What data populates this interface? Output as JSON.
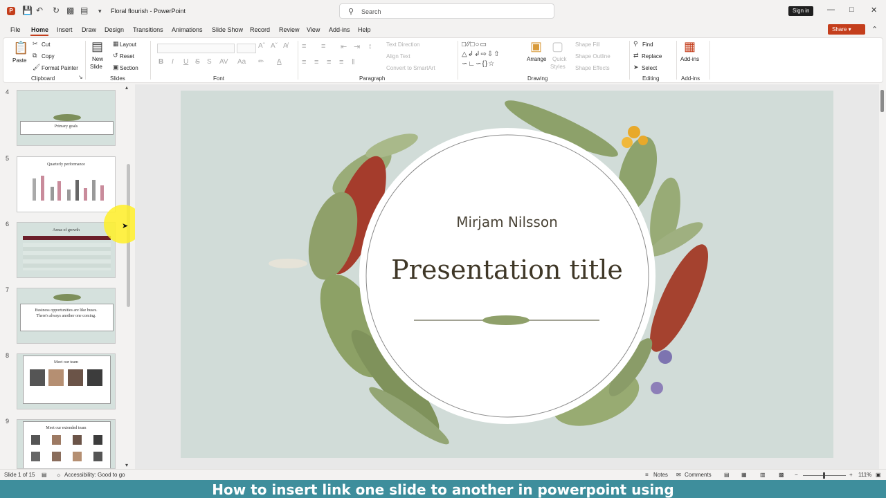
{
  "window": {
    "title": "Floral flourish  -  PowerPoint",
    "app_icon_letter": "P",
    "search_placeholder": "Search",
    "signin_label": "Sign in"
  },
  "menu": {
    "tabs": [
      "File",
      "Home",
      "Insert",
      "Draw",
      "Design",
      "Transitions",
      "Animations",
      "Slide Show",
      "Record",
      "Review",
      "View",
      "Add-ins",
      "Help"
    ],
    "active_tab": "Home",
    "share_label": "Share"
  },
  "ribbon": {
    "clipboard": {
      "paste": "Paste",
      "cut": "Cut",
      "copy": "Copy",
      "format_painter": "Format Painter",
      "label": "Clipboard"
    },
    "slides": {
      "new_slide_line1": "New",
      "new_slide_line2": "Slide",
      "layout": "Layout",
      "reset": "Reset",
      "section": "Section",
      "label": "Slides"
    },
    "font": {
      "label": "Font"
    },
    "paragraph": {
      "text_direction": "Text Direction",
      "align_text": "Align Text",
      "convert_smartart": "Convert to SmartArt",
      "label": "Paragraph"
    },
    "drawing": {
      "arrange": "Arrange",
      "quick_styles_line1": "Quick",
      "quick_styles_line2": "Styles",
      "shape_fill": "Shape Fill",
      "shape_outline": "Shape Outline",
      "shape_effects": "Shape Effects",
      "label": "Drawing"
    },
    "editing": {
      "find": "Find",
      "replace": "Replace",
      "select": "Select",
      "label": "Editing"
    },
    "addins": {
      "button": "Add-ins",
      "label": "Add-ins"
    }
  },
  "thumbnails": [
    {
      "num": "4",
      "title": "Primary goals"
    },
    {
      "num": "5",
      "title": "Quarterly performance"
    },
    {
      "num": "6",
      "title": "Areas of growth"
    },
    {
      "num": "7",
      "title": "Business opportunities are like buses. There's always another one coming."
    },
    {
      "num": "8",
      "title": "Meet our team"
    },
    {
      "num": "9",
      "title": "Meet our extended team"
    }
  ],
  "slide": {
    "presenter": "Mirjam Nilsson",
    "title": "Presentation title"
  },
  "status": {
    "slide_info": "Slide 1 of 15",
    "accessibility": "Accessibility: Good to go",
    "notes": "Notes",
    "comments": "Comments",
    "zoom": "111%"
  },
  "caption": "How to insert link one slide to another in powerpoint using",
  "colors": {
    "accent": "#c43e1c",
    "slide_bg": "#d1dcd8",
    "caption_bg": "#3e8e9c"
  }
}
